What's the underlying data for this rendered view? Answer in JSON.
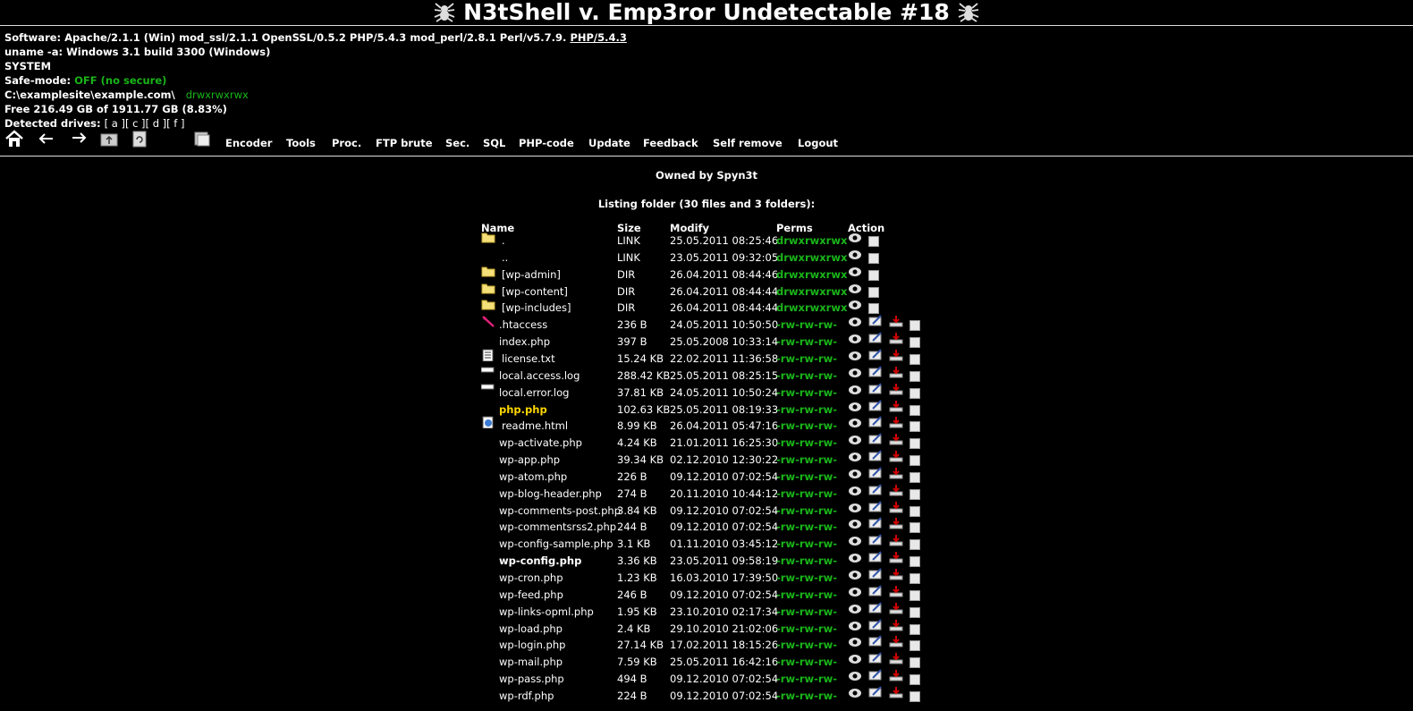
{
  "header": {
    "title": "N3tShell v. Emp3ror Undetectable #18",
    "software_label": "Software:",
    "software_value": "Apache/2.1.1 (Win) mod_ssl/2.1.1 OpenSSL/0.5.2 PHP/5.4.3 mod_perl/2.8.1 Perl/v5.7.9.",
    "php_link": "PHP/5.4.3",
    "uname_label": "uname -a:",
    "uname_value": "Windows 3.1 build 3300 (Windows)",
    "user": "SYSTEM",
    "safemode_label": "Safe-mode:",
    "safemode_value": "OFF (no secure)",
    "path": "C:\\examplesite\\example.com\\",
    "path_perms": "drwxrwxrwx",
    "free_space": "Free 216.49 GB of 1911.77 GB (8.83%)",
    "drives_label": "Detected drives:",
    "drives": [
      "[ a ]",
      "[ c ]",
      "[ d ]",
      "[ f ]"
    ]
  },
  "toolbar": {
    "icons": [
      "home-icon",
      "back-icon",
      "forward-icon",
      "up-folder-icon",
      "refresh-icon",
      "search-icon"
    ],
    "links": [
      "Encoder",
      "Tools",
      "Proc.",
      "FTP brute",
      "Sec.",
      "SQL",
      "PHP-code",
      "Update",
      "Feedback",
      "Self remove",
      "Logout"
    ]
  },
  "owned": "Owned by Spyn3t",
  "listing_title": "Listing folder (30 files and 3 folders):",
  "columns": [
    "Name",
    "Size",
    "Modify",
    "Perms",
    "Action"
  ],
  "rows": [
    {
      "icon": "folder-icon",
      "name": ".",
      "size": "LINK",
      "modify": "25.05.2011 08:25:46",
      "perms": "drwxrwxrwx",
      "kind": "dir"
    },
    {
      "icon": "",
      "name": "..",
      "size": "LINK",
      "modify": "23.05.2011 09:32:05",
      "perms": "drwxrwxrwx",
      "kind": "dir"
    },
    {
      "icon": "folder-icon",
      "name": "[wp-admin]",
      "size": "DIR",
      "modify": "26.04.2011 08:44:46",
      "perms": "drwxrwxrwx",
      "kind": "dir"
    },
    {
      "icon": "folder-icon",
      "name": "[wp-content]",
      "size": "DIR",
      "modify": "26.04.2011 08:44:44",
      "perms": "drwxrwxrwx",
      "kind": "dir"
    },
    {
      "icon": "folder-icon",
      "name": "[wp-includes]",
      "size": "DIR",
      "modify": "26.04.2011 08:44:44",
      "perms": "drwxrwxrwx",
      "kind": "dir"
    },
    {
      "icon": "feather-icon",
      "name": ".htaccess",
      "size": "236 B",
      "modify": "24.05.2011 10:50:50",
      "perms": "-rw-rw-rw-",
      "kind": "file"
    },
    {
      "icon": "",
      "name": "index.php",
      "size": "397 B",
      "modify": "25.05.2008 10:33:14",
      "perms": "-rw-rw-rw-",
      "kind": "file"
    },
    {
      "icon": "text-file-icon",
      "name": "license.txt",
      "size": "15.24 KB",
      "modify": "22.02.2011 11:36:58",
      "perms": "-rw-rw-rw-",
      "kind": "file"
    },
    {
      "icon": "log-icon",
      "name": "local.access.log",
      "size": "288.42 KB",
      "modify": "25.05.2011 08:25:15",
      "perms": "-rw-rw-rw-",
      "kind": "file"
    },
    {
      "icon": "log-icon",
      "name": "local.error.log",
      "size": "37.81 KB",
      "modify": "24.05.2011 10:50:24",
      "perms": "-rw-rw-rw-",
      "kind": "file"
    },
    {
      "icon": "",
      "name": "php.php",
      "size": "102.63 KB",
      "modify": "25.05.2011 08:19:33",
      "perms": "-rw-rw-rw-",
      "kind": "file",
      "style": "yellow"
    },
    {
      "icon": "html-file-icon",
      "name": "readme.html",
      "size": "8.99 KB",
      "modify": "26.04.2011 05:47:16",
      "perms": "-rw-rw-rw-",
      "kind": "file"
    },
    {
      "icon": "",
      "name": "wp-activate.php",
      "size": "4.24 KB",
      "modify": "21.01.2011 16:25:30",
      "perms": "-rw-rw-rw-",
      "kind": "file"
    },
    {
      "icon": "",
      "name": "wp-app.php",
      "size": "39.34 KB",
      "modify": "02.12.2010 12:30:22",
      "perms": "-rw-rw-rw-",
      "kind": "file"
    },
    {
      "icon": "",
      "name": "wp-atom.php",
      "size": "226 B",
      "modify": "09.12.2010 07:02:54",
      "perms": "-rw-rw-rw-",
      "kind": "file"
    },
    {
      "icon": "",
      "name": "wp-blog-header.php",
      "size": "274 B",
      "modify": "20.11.2010 10:44:12",
      "perms": "-rw-rw-rw-",
      "kind": "file"
    },
    {
      "icon": "",
      "name": "wp-comments-post.php",
      "size": "3.84 KB",
      "modify": "09.12.2010 07:02:54",
      "perms": "-rw-rw-rw-",
      "kind": "file"
    },
    {
      "icon": "",
      "name": "wp-commentsrss2.php",
      "size": "244 B",
      "modify": "09.12.2010 07:02:54",
      "perms": "-rw-rw-rw-",
      "kind": "file"
    },
    {
      "icon": "",
      "name": "wp-config-sample.php",
      "size": "3.1 KB",
      "modify": "01.11.2010 03:45:12",
      "perms": "-rw-rw-rw-",
      "kind": "file"
    },
    {
      "icon": "",
      "name": "wp-config.php",
      "size": "3.36 KB",
      "modify": "23.05.2011 09:58:19",
      "perms": "-rw-rw-rw-",
      "kind": "file",
      "style": "bold"
    },
    {
      "icon": "",
      "name": "wp-cron.php",
      "size": "1.23 KB",
      "modify": "16.03.2010 17:39:50",
      "perms": "-rw-rw-rw-",
      "kind": "file"
    },
    {
      "icon": "",
      "name": "wp-feed.php",
      "size": "246 B",
      "modify": "09.12.2010 07:02:54",
      "perms": "-rw-rw-rw-",
      "kind": "file"
    },
    {
      "icon": "",
      "name": "wp-links-opml.php",
      "size": "1.95 KB",
      "modify": "23.10.2010 02:17:34",
      "perms": "-rw-rw-rw-",
      "kind": "file"
    },
    {
      "icon": "",
      "name": "wp-load.php",
      "size": "2.4 KB",
      "modify": "29.10.2010 21:02:06",
      "perms": "-rw-rw-rw-",
      "kind": "file"
    },
    {
      "icon": "",
      "name": "wp-login.php",
      "size": "27.14 KB",
      "modify": "17.02.2011 18:15:26",
      "perms": "-rw-rw-rw-",
      "kind": "file"
    },
    {
      "icon": "",
      "name": "wp-mail.php",
      "size": "7.59 KB",
      "modify": "25.05.2011 16:42:16",
      "perms": "-rw-rw-rw-",
      "kind": "file"
    },
    {
      "icon": "",
      "name": "wp-pass.php",
      "size": "494 B",
      "modify": "09.12.2010 07:02:54",
      "perms": "-rw-rw-rw-",
      "kind": "file"
    },
    {
      "icon": "",
      "name": "wp-rdf.php",
      "size": "224 B",
      "modify": "09.12.2010 07:02:54",
      "perms": "-rw-rw-rw-",
      "kind": "file"
    }
  ]
}
